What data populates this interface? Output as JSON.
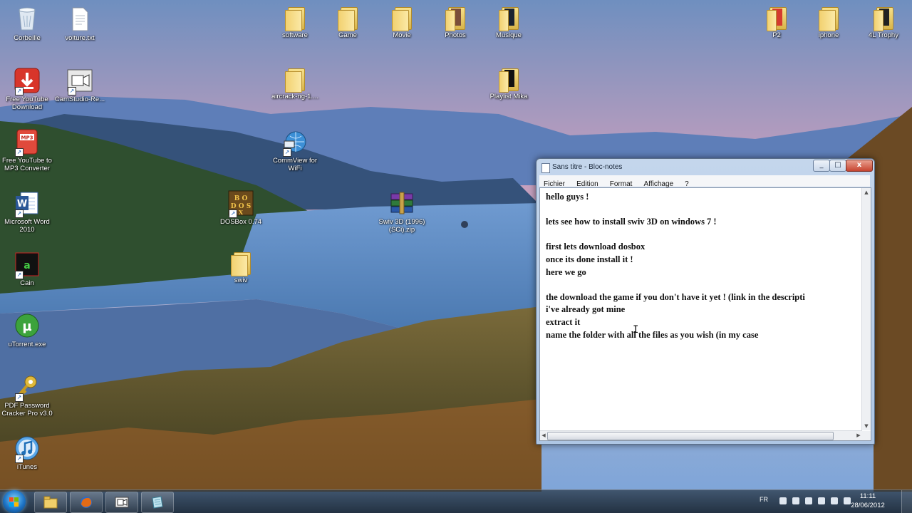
{
  "desktop": {
    "icons": [
      {
        "label": "Corbeille",
        "icon": "recycle-bin-icon"
      },
      {
        "label": "voiture.txt",
        "icon": "text-file-icon"
      },
      {
        "label": "software",
        "icon": "folder-icon"
      },
      {
        "label": "Game",
        "icon": "folder-icon"
      },
      {
        "label": "Movie",
        "icon": "folder-icon"
      },
      {
        "label": "Photos",
        "icon": "folder-icon"
      },
      {
        "label": "Musique",
        "icon": "folder-icon"
      },
      {
        "label": "P2",
        "icon": "folder-icon"
      },
      {
        "label": "iphone",
        "icon": "folder-icon"
      },
      {
        "label": "4L Trophy",
        "icon": "folder-icon"
      },
      {
        "label": "Free YouTube Download",
        "icon": "download-arrow-icon"
      },
      {
        "label": "CamStudio-Re...",
        "icon": "camera-icon"
      },
      {
        "label": "aircrack-ng-1....",
        "icon": "folder-icon"
      },
      {
        "label": "Playlist Mika",
        "icon": "folder-icon"
      },
      {
        "label": "Free YouTube to MP3 Converter",
        "icon": "mp3-icon"
      },
      {
        "label": "CommView for WiFi",
        "icon": "network-globe-icon"
      },
      {
        "label": "Microsoft Word 2010",
        "icon": "word-icon"
      },
      {
        "label": "DOSBox 0.74",
        "icon": "dosbox-icon"
      },
      {
        "label": "Swiv 3D (1996)(SCi).zip",
        "icon": "winrar-archive-icon"
      },
      {
        "label": "Cain",
        "icon": "cain-icon"
      },
      {
        "label": "swiv",
        "icon": "folder-icon"
      },
      {
        "label": "uTorrent.exe",
        "icon": "utorrent-icon"
      },
      {
        "label": "PDF Password Cracker Pro v3.0",
        "icon": "key-icon"
      },
      {
        "label": "iTunes",
        "icon": "itunes-icon"
      }
    ]
  },
  "notepad": {
    "title": "Sans titre - Bloc-notes",
    "menu": [
      "Fichier",
      "Edition",
      "Format",
      "Affichage",
      "?"
    ],
    "text": "hello guys !\n\nlets see how to install swiv 3D on windows 7 !\n\nfirst lets download dosbox\nonce its done install it !\nhere we go\n\nthe download the game if you don't have it yet ! (link in the descripti\ni've already got mine\nextract it\nname the folder with all the files as you wish (in my case",
    "close_symbol": "x",
    "min_symbol": "_",
    "max_symbol": "□"
  },
  "taskbar": {
    "pinned": [
      "explorer-icon",
      "firefox-icon",
      "camstudio-icon",
      "notepad-icon"
    ],
    "language": "FR",
    "time": "11:11",
    "date": "28/06/2012"
  }
}
